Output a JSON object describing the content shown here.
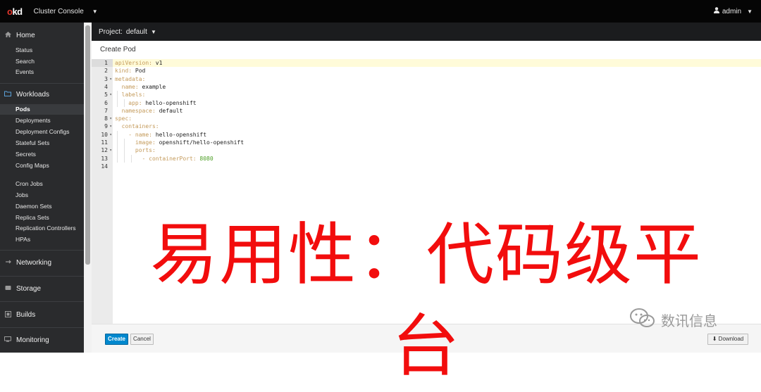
{
  "topbar": {
    "logo_o": "o",
    "logo_rest": "kd",
    "console_label": "Cluster Console",
    "user_label": "admin"
  },
  "sidebar": {
    "sections": [
      {
        "label": "Home",
        "icon": "home-icon",
        "items": [
          "Status",
          "Search",
          "Events"
        ]
      },
      {
        "label": "Workloads",
        "icon": "folder-icon",
        "items": [
          "Pods",
          "Deployments",
          "Deployment Configs",
          "Stateful Sets",
          "Secrets",
          "Config Maps",
          "Cron Jobs",
          "Jobs",
          "Daemon Sets",
          "Replica Sets",
          "Replication Controllers",
          "HPAs"
        ]
      },
      {
        "label": "Networking",
        "icon": "network-icon",
        "items": []
      },
      {
        "label": "Storage",
        "icon": "storage-icon",
        "items": []
      },
      {
        "label": "Builds",
        "icon": "builds-icon",
        "items": []
      },
      {
        "label": "Monitoring",
        "icon": "monitor-icon",
        "items": []
      }
    ],
    "active_item": "Pods"
  },
  "project_bar": {
    "label": "Project:",
    "project": "default"
  },
  "page_title": "Create Pod",
  "editor": {
    "line_numbers": [
      "1",
      "2",
      "3",
      "4",
      "5",
      "6",
      "7",
      "8",
      "9",
      "10",
      "11",
      "12",
      "13",
      "14"
    ],
    "lines": [
      {
        "key": "apiVersion:",
        "value": " v1"
      },
      {
        "key": "kind:",
        "value": " Pod"
      },
      {
        "key": "metadata:",
        "value": ""
      },
      {
        "key": "  name:",
        "value": " example"
      },
      {
        "key": "  labels:",
        "value": ""
      },
      {
        "key": "    app:",
        "value": " hello-openshift"
      },
      {
        "key": "  namespace:",
        "value": " default"
      },
      {
        "key": "spec:",
        "value": ""
      },
      {
        "key": "  containers:",
        "value": ""
      },
      {
        "key": "    - name:",
        "value": " hello-openshift"
      },
      {
        "key": "      image:",
        "value": " openshift/hello-openshift"
      },
      {
        "key": "      ports:",
        "value": ""
      },
      {
        "key": "        - containerPort:",
        "value": " 8080"
      },
      {
        "key": "",
        "value": ""
      }
    ]
  },
  "footer": {
    "create_label": "Create",
    "cancel_label": "Cancel",
    "download_label": "Download"
  },
  "overlay_text": "易用性：代码级平台",
  "watermark_text": "数讯信息",
  "colors": {
    "accent": "#0088ce",
    "overlay": "#f20d0d",
    "yaml_key": "#c49a5a",
    "yaml_number": "#4fa028"
  }
}
